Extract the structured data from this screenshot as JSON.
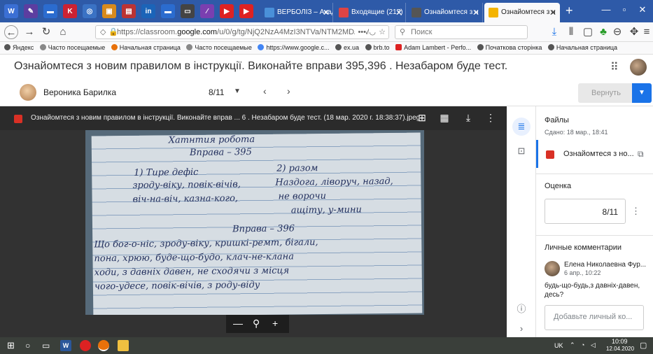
{
  "browser": {
    "tabs": [
      {
        "label": "ВЕРБОЛІЗ – Акад",
        "color": "#4a90d9"
      },
      {
        "label": "Входящие (217)",
        "color": "#d44"
      },
      {
        "label": "Ознайомтеся з н",
        "color": "#555"
      },
      {
        "label": "Ознайомтеся з н",
        "color": "#f4b400",
        "active": true
      }
    ],
    "url_prefix": "https://classroom.",
    "url_domain": "google.com",
    "url_rest": "/u/0/g/tg/NjQ2NzA4MzI3NTVa/NTM2MDA2M",
    "url_more": "•••",
    "search_placeholder": "Поиск",
    "bookmarks": [
      "Яндекс",
      "Часто посещаемые",
      "Начальная страница",
      "Часто посещаемые",
      "https://www.google.c...",
      "ex.ua",
      "brb.to",
      "Adam Lambert - Perfo...",
      "Початкова сторінка",
      "Начальная страница"
    ]
  },
  "classroom": {
    "title": "Ознайомтеся з новим правилом в інструкції. Виконайте вправи 395,396 . Незабаром буде тест.",
    "student_name": "Вероника Барилка",
    "student_score": "8/11",
    "return_label": "Вернуть"
  },
  "viewer": {
    "file_title": "Ознайомтеся з новим правилом в інструкції. Виконайте вправ ... 6 . Незабаром буде тест. (18 мар. 2020 г. 18:38:37).jpeg",
    "handwriting": [
      "Хатнтия робота",
      "Вправа – 395",
      "1) Тире дефіс",
      "2) разом",
      "зроду-віку, повік-вічів,",
      "Наздога, ліворуч, назад,",
      "віч-на-віч, казна-кого,",
      "не ворочи",
      "Вправа – 396",
      "Що бог-о-ніс, зроду-віку, кришкі-ремт, бігали,",
      "пона, хрюю, буде-що-будо, клач-не-клана",
      "ходи, з давніх давен, не сходячи з місця",
      "чого-удесе, повік-вічів, з роду-віду",
      "ащіту, у-мини"
    ]
  },
  "panel": {
    "files_title": "Файлы",
    "submitted": "Сдано: 18 мар., 18:41",
    "file_name": "Ознайомтеся з но...",
    "grade_title": "Оценка",
    "grade_value": "8/11",
    "comments_title": "Личные комментарии",
    "comment_author": "Елена Николаевна Фур...",
    "comment_date": "6 апр., 10:22",
    "comment_text": "будь-що-будь,з давніх-давен, десь?",
    "comment_placeholder": "Добавьте личный ко..."
  },
  "taskbar": {
    "lang": "UK",
    "time": "10:09",
    "date": "12.04.2020"
  }
}
